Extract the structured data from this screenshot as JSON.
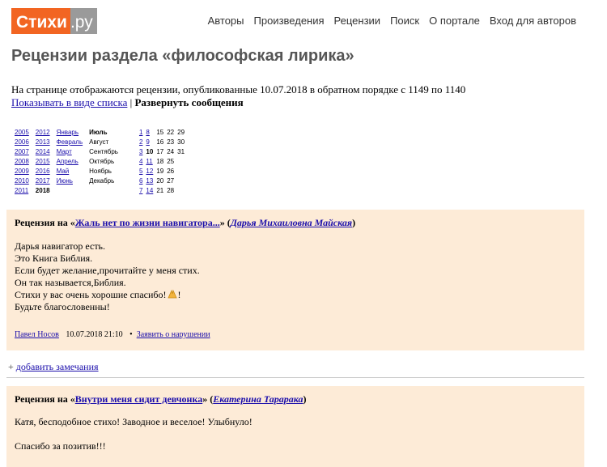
{
  "logo": {
    "part1": "Стихи",
    "part2": ".ру"
  },
  "nav": [
    "Авторы",
    "Произведения",
    "Рецензии",
    "Поиск",
    "О портале",
    "Вход для авторов"
  ],
  "page_title": "Рецензии раздела «философская лирика»",
  "intro": {
    "line": "На странице отображаются рецензии, опубликованные 10.07.2018 в обратном порядке с 1149 по 1140",
    "link_list": "Показывать в виде списка",
    "separator": "|",
    "expand": "Развернуть сообщения"
  },
  "calendar": {
    "years_a": [
      "2005",
      "2006",
      "2007",
      "2008",
      "2009",
      "2010",
      "2011"
    ],
    "years_b": [
      "2012",
      "2013",
      "2014",
      "2015",
      "2016",
      "2017",
      "2018"
    ],
    "months_a": [
      "Январь",
      "Февраль",
      "Март",
      "Апрель",
      "Май",
      "Июнь",
      ""
    ],
    "months_b": [
      "Июль",
      "Август",
      "Сентябрь",
      "Октябрь",
      "Ноябрь",
      "Декабрь",
      ""
    ],
    "days": [
      [
        "1",
        "8",
        "15",
        "22",
        "29"
      ],
      [
        "2",
        "9",
        "16",
        "23",
        "30"
      ],
      [
        "3",
        "10",
        "17",
        "24",
        "31"
      ],
      [
        "4",
        "11",
        "18",
        "25",
        ""
      ],
      [
        "5",
        "12",
        "19",
        "26",
        ""
      ],
      [
        "6",
        "13",
        "20",
        "27",
        ""
      ],
      [
        "7",
        "14",
        "21",
        "28",
        ""
      ]
    ]
  },
  "reviews": [
    {
      "prefix": "Рецензия на «",
      "work": "Жаль нет по жизни навигатора...",
      "mid": "» (",
      "author": "Дарья Михаиловна Майская",
      "suffix": ")",
      "lines": [
        "Дарья навигатор есть.",
        "Это Книга Библия.",
        "Если будет желание,прочитайте у меня стих.",
        "Он так называется,Библия.",
        "Стихи у вас очень хорошие спасибо!",
        "Будьте благословенны!"
      ],
      "pray_suffix": "!",
      "reviewer": "Павел Носов",
      "date": "10.07.2018 21:10",
      "bullet": "•",
      "report": "Заявить о нарушении"
    },
    {
      "prefix": "Рецензия на «",
      "work": "Внутри меня сидит девчонка",
      "mid": "» (",
      "author": "Екатерина Тарарака",
      "suffix": ")",
      "lines": [
        "Катя, бесподобное стихо! Заводное и веселое! Улыбнуло!",
        "",
        "Спасибо за позитив!!!"
      ]
    }
  ],
  "add_comment": {
    "plus": "+",
    "label": "добавить замечания"
  },
  "colors": {
    "logo_orange": "#f26522",
    "logo_gray": "#9a9a9a",
    "review_bg": "#fdebd7",
    "link": "#1a0dab"
  }
}
